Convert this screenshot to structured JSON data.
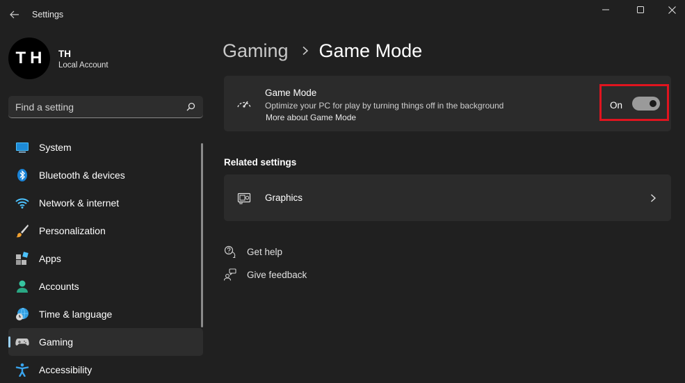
{
  "window": {
    "title": "Settings",
    "controls": {
      "minimize": "minimize-icon",
      "maximize": "maximize-icon",
      "close": "close-icon"
    }
  },
  "profile": {
    "initials": "TH",
    "name": "TH",
    "account_type": "Local Account"
  },
  "search": {
    "placeholder": "Find a setting",
    "value": ""
  },
  "sidebar": {
    "items": [
      {
        "label": "System",
        "icon": "monitor-icon"
      },
      {
        "label": "Bluetooth & devices",
        "icon": "bluetooth-icon"
      },
      {
        "label": "Network & internet",
        "icon": "wifi-icon"
      },
      {
        "label": "Personalization",
        "icon": "brush-icon"
      },
      {
        "label": "Apps",
        "icon": "apps-icon"
      },
      {
        "label": "Accounts",
        "icon": "person-icon"
      },
      {
        "label": "Time & language",
        "icon": "globe-clock-icon"
      },
      {
        "label": "Gaming",
        "icon": "gamepad-icon",
        "selected": true
      },
      {
        "label": "Accessibility",
        "icon": "accessibility-icon"
      }
    ]
  },
  "breadcrumb": {
    "parent": "Gaming",
    "current": "Game Mode"
  },
  "game_mode": {
    "title": "Game Mode",
    "description": "Optimize your PC for play by turning things off in the background",
    "link": "More about Game Mode",
    "toggle_label": "On",
    "enabled": true
  },
  "related": {
    "title": "Related settings",
    "items": [
      {
        "label": "Graphics"
      }
    ]
  },
  "help": {
    "get_help": "Get help",
    "give_feedback": "Give feedback"
  },
  "colors": {
    "background": "#202020",
    "card": "#2b2b2b",
    "accent": "#9ad0f5",
    "highlight": "#e0141f"
  }
}
